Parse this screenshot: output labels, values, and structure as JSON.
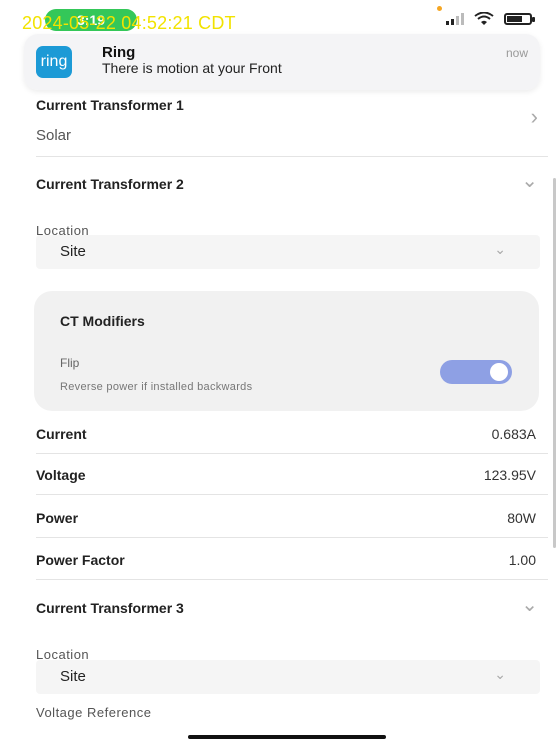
{
  "status_bar": {
    "time": "3:19",
    "timestamp_overlay": "2024-05-22 04:52:21 CDT",
    "orange_dot_color": "#f5a623"
  },
  "notification": {
    "app_icon_text": "ring",
    "title": "Ring",
    "body": "There is motion at your Front",
    "time": "now"
  },
  "ct1": {
    "label": "Current Transformer 1",
    "value": "Solar"
  },
  "ct2": {
    "label": "Current Transformer 2",
    "location_label": "Location",
    "location_value": "Site",
    "modifiers": {
      "title": "CT Modifiers",
      "flip_label": "Flip",
      "flip_desc": "Reverse power if installed backwards",
      "flip_on": true,
      "toggle_color": "#8ea0e4"
    },
    "metrics": [
      {
        "label": "Current",
        "value": "0.683A"
      },
      {
        "label": "Voltage",
        "value": "123.95V"
      },
      {
        "label": "Power",
        "value": "80W"
      },
      {
        "label": "Power Factor",
        "value": "1.00"
      }
    ]
  },
  "ct3": {
    "label": "Current Transformer 3",
    "location_label": "Location",
    "location_value": "Site",
    "voltage_reference_label": "Voltage Reference"
  },
  "icons": {
    "chevron_right": "›",
    "chevron_down": "⌄"
  }
}
